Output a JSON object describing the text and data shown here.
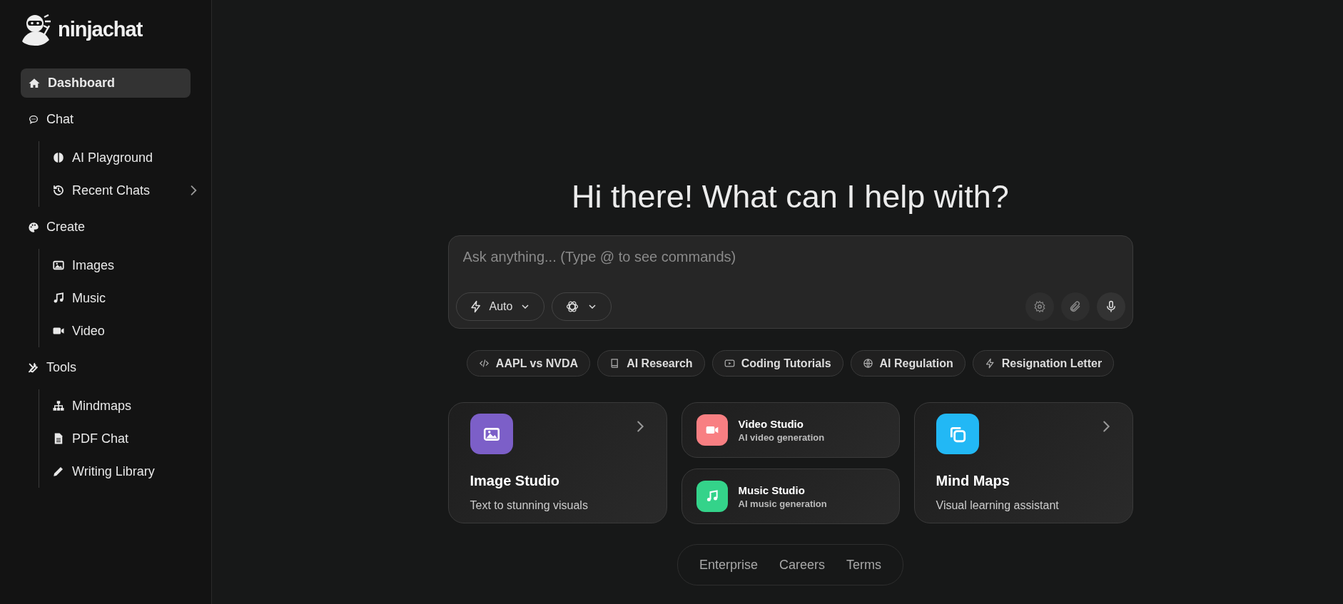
{
  "brand": "ninjachat",
  "nav": [
    {
      "label": "Dashboard",
      "selected": true
    },
    {
      "label": "Chat",
      "selected": false,
      "children": [
        {
          "label": "AI Playground",
          "selected": false,
          "has_submenu": false
        },
        {
          "label": "Recent Chats",
          "selected": false,
          "has_submenu": true
        }
      ]
    },
    {
      "label": "Create",
      "selected": false,
      "children": [
        {
          "label": "Images",
          "selected": false,
          "has_submenu": false
        },
        {
          "label": "Music",
          "selected": false,
          "has_submenu": false
        },
        {
          "label": "Video",
          "selected": false,
          "has_submenu": false
        }
      ]
    },
    {
      "label": "Tools",
      "selected": false,
      "children": [
        {
          "label": "Mindmaps",
          "selected": false,
          "has_submenu": false
        },
        {
          "label": "PDF Chat",
          "selected": false,
          "has_submenu": false
        },
        {
          "label": "Writing Library",
          "selected": false,
          "has_submenu": false
        }
      ]
    }
  ],
  "heading": "Hi there! What can I help with?",
  "composer": {
    "placeholder": "Ask anything... (Type @ to see commands)",
    "mode": "Auto"
  },
  "suggestions": [
    "AAPL vs NVDA",
    "AI Research",
    "Coding Tutorials",
    "AI Regulation",
    "Resignation Letter"
  ],
  "features": [
    {
      "kind": "large",
      "title": "Image Studio",
      "subtitle": "Text to stunning visuals",
      "color": "#7c5fc8"
    },
    {
      "kind": "small",
      "title": "Video Studio",
      "subtitle": "AI video generation",
      "color": "#f87f82"
    },
    {
      "kind": "small",
      "title": "Music Studio",
      "subtitle": "AI music generation",
      "color": "#34d38a"
    },
    {
      "kind": "large",
      "title": "Mind Maps",
      "subtitle": "Visual learning assistant",
      "color": "#22b8f5"
    }
  ],
  "footer_links": [
    "Enterprise",
    "Careers",
    "Terms"
  ]
}
